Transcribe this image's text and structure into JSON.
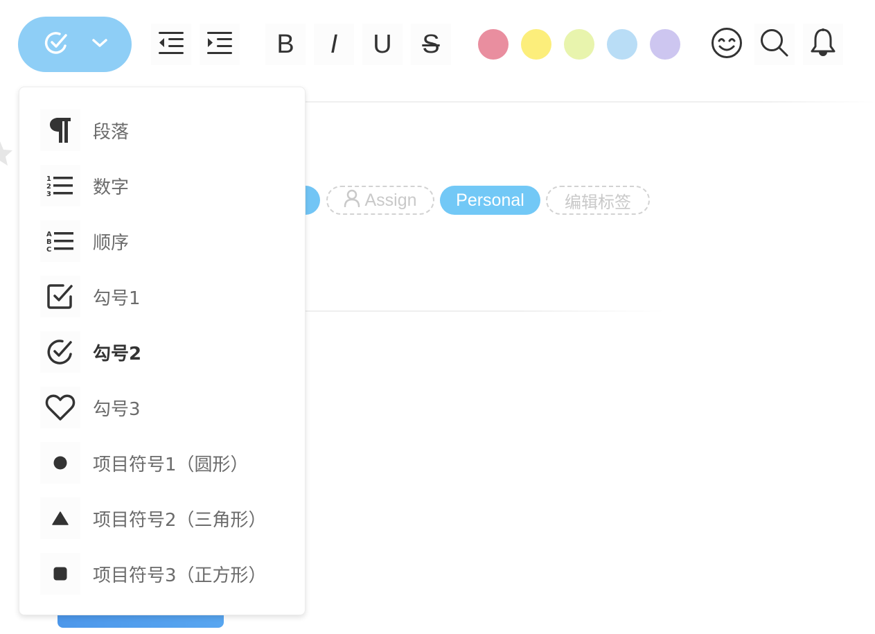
{
  "toolbar": {
    "list_type_button": {
      "current_icon": "check-circle-icon",
      "chevron": "chevron-down-icon"
    },
    "indent_buttons": [
      {
        "name": "outdent",
        "icon": "outdent-icon"
      },
      {
        "name": "indent",
        "icon": "indent-icon"
      }
    ],
    "format_buttons": [
      {
        "name": "bold",
        "label": "B"
      },
      {
        "name": "italic",
        "label": "I"
      },
      {
        "name": "underline",
        "label": "U"
      },
      {
        "name": "strikethrough",
        "label": "S"
      }
    ],
    "color_swatches": [
      {
        "name": "red",
        "color": "#e98e9f"
      },
      {
        "name": "yellow",
        "color": "#fcee7b"
      },
      {
        "name": "lime",
        "color": "#e8f4ad"
      },
      {
        "name": "blue",
        "color": "#b9ddf6"
      },
      {
        "name": "purple",
        "color": "#cdc6f0"
      }
    ],
    "right_icons": [
      {
        "name": "emoji",
        "icon": "emoji-icon"
      },
      {
        "name": "search",
        "icon": "search-icon"
      },
      {
        "name": "notifications",
        "icon": "bell-icon"
      }
    ]
  },
  "dropdown": {
    "items": [
      {
        "label": "段落",
        "icon": "paragraph-icon",
        "selected": false
      },
      {
        "label": "数字",
        "icon": "numbered-list-icon",
        "selected": false
      },
      {
        "label": "顺序",
        "icon": "alpha-list-icon",
        "selected": false
      },
      {
        "label": "勾号1",
        "icon": "checkbox-icon",
        "selected": false
      },
      {
        "label": "勾号2",
        "icon": "check-circle-icon",
        "selected": true
      },
      {
        "label": "勾号3",
        "icon": "heart-icon",
        "selected": false
      },
      {
        "label": "项目符号1（圆形）",
        "icon": "circle-bullet-icon",
        "selected": false
      },
      {
        "label": "项目符号2（三角形）",
        "icon": "triangle-bullet-icon",
        "selected": false
      },
      {
        "label": "项目符号3（正方形）",
        "icon": "square-bullet-icon",
        "selected": false
      }
    ]
  },
  "tags": {
    "assign_label": "Assign",
    "personal_label": "Personal",
    "edit_tags_label": "编辑标签"
  },
  "colors": {
    "accent": "#8ecef6",
    "tag_blue": "#72c8f6",
    "icon_dark": "#333333",
    "text_gray": "#6b6b6b",
    "placeholder_gray": "#c9c9c9"
  }
}
